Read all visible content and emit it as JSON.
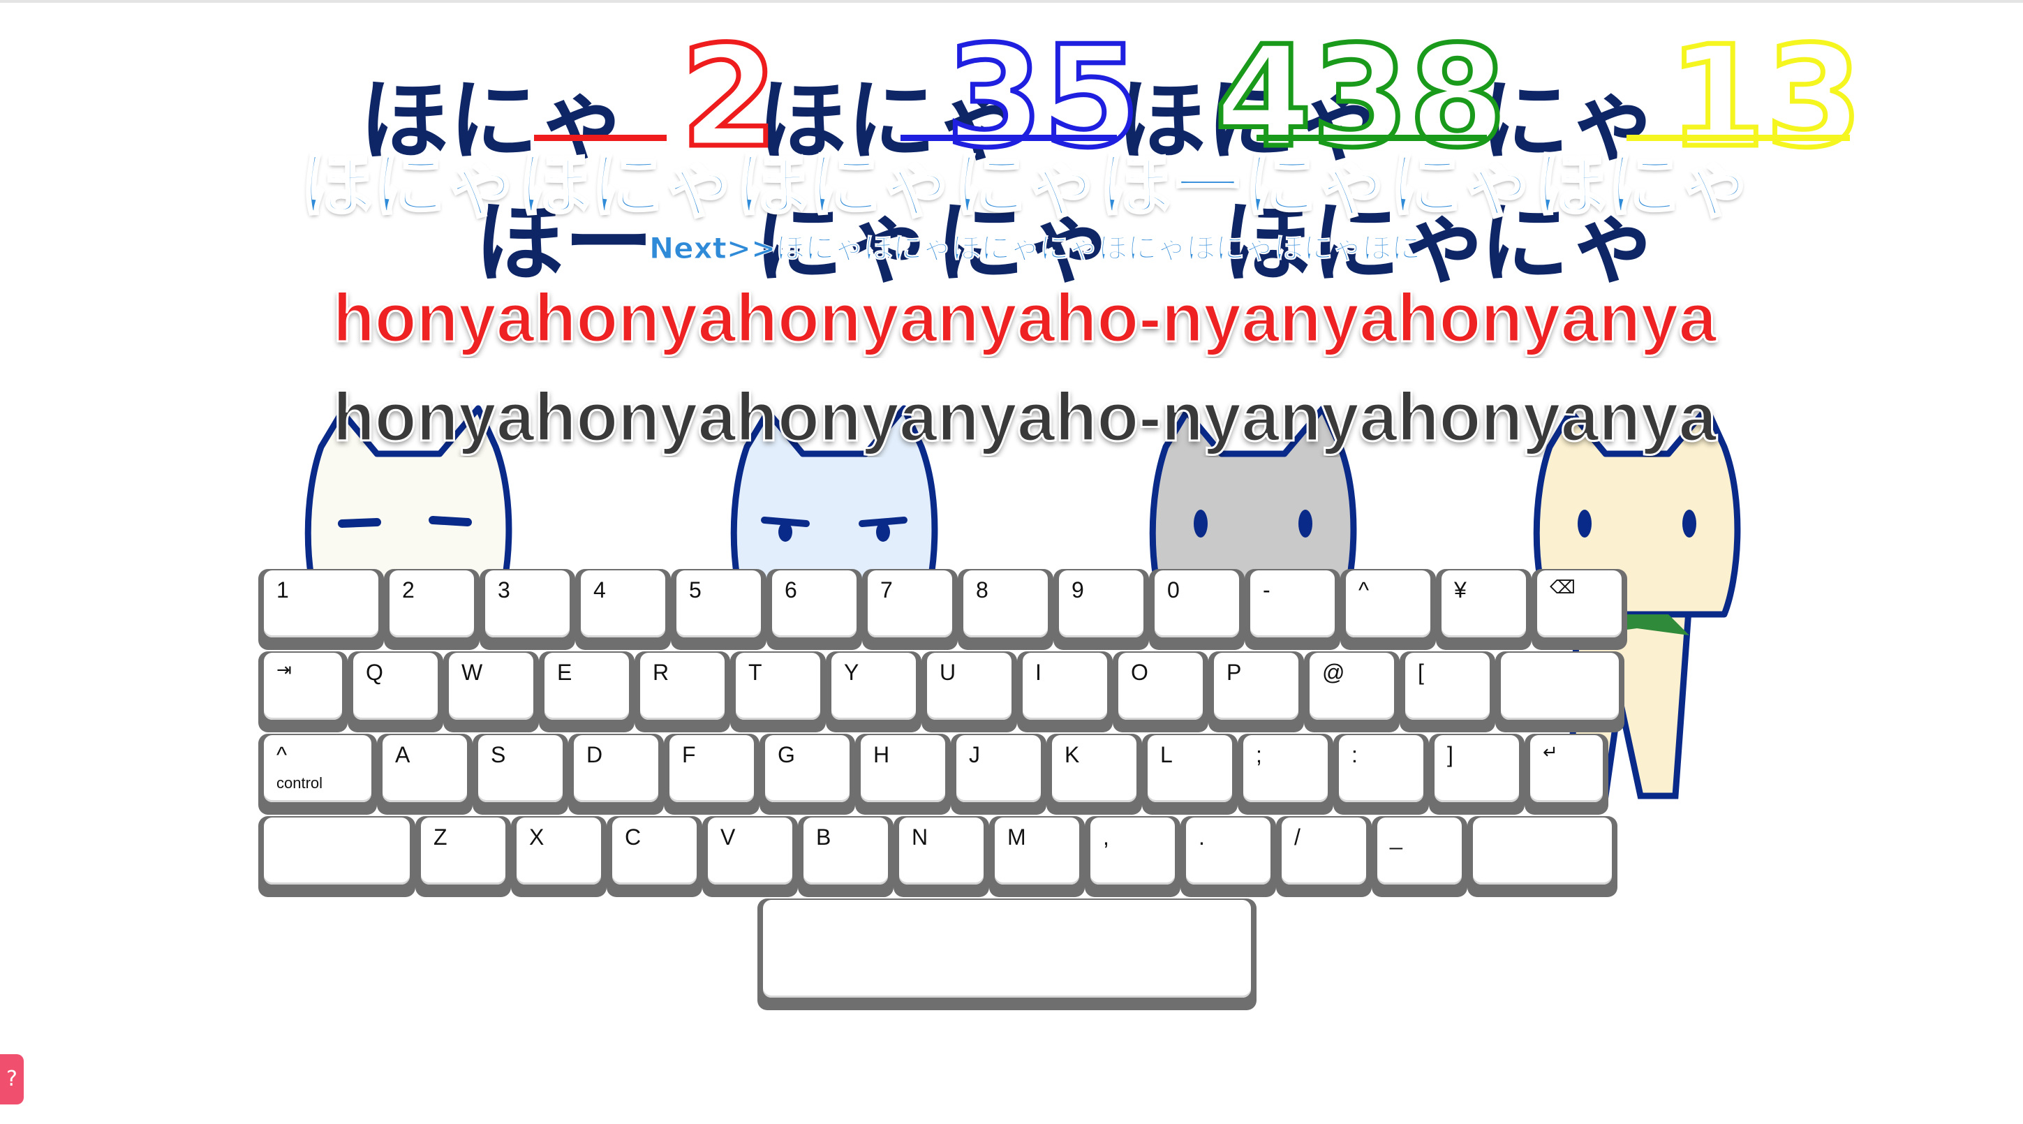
{
  "background_words": [
    {
      "text": "ほにゃ",
      "color": "#0e2566"
    },
    {
      "text": "ほにゃ",
      "color": "#0e2566"
    },
    {
      "text": "ほにゃ",
      "color": "#0e2566"
    },
    {
      "text": "にゃ",
      "color": "#0e2566"
    },
    {
      "text": "ほー",
      "color": "#0e2566"
    },
    {
      "text": "にゃ",
      "color": "#0e2566"
    },
    {
      "text": "にゃ",
      "color": "#0e2566"
    },
    {
      "text": "ほにゃ",
      "color": "#0e2566"
    },
    {
      "text": "にゃ",
      "color": "#0e2566"
    }
  ],
  "scores": [
    {
      "value": "2",
      "color": "#ee1c1c"
    },
    {
      "value": "35",
      "color": "#1f1fe0"
    },
    {
      "value": "438",
      "color": "#1a9a1a"
    },
    {
      "value": "13",
      "color": "#f5f520"
    }
  ],
  "typing": {
    "current_kana": "ほにゃほにゃほにゃにゃほーにゃにゃほにゃにゃ",
    "next_label": "Next>>",
    "next_kana": "ほにゃほにゃほにゃにゃほにゃほにゃほにゃほにゃ",
    "typed_romaji": "honyahonyahonyanyaho-nyanyahonyanya",
    "remaining_romaji": "honyahonyahonyanyaho-nyanyahonyanya"
  },
  "cats": [
    {
      "name": "white-cat",
      "body_color": "#fbfaf2",
      "accent_color": "#e0401e"
    },
    {
      "name": "blue-cat",
      "body_color": "#e2eefb",
      "accent_color": "#2a6ee0"
    },
    {
      "name": "gray-cat",
      "body_color": "#c9c9c9",
      "accent_color": "#6a5fb0"
    },
    {
      "name": "cream-cat",
      "body_color": "#fbf0cf",
      "accent_color": "#2f8a3a"
    }
  ],
  "keyboard": {
    "rows": [
      [
        {
          "label": "1"
        },
        {
          "label": "2"
        },
        {
          "label": "3"
        },
        {
          "label": "4"
        },
        {
          "label": "5"
        },
        {
          "label": "6"
        },
        {
          "label": "7"
        },
        {
          "label": "8"
        },
        {
          "label": "9"
        },
        {
          "label": "0"
        },
        {
          "label": "-"
        },
        {
          "label": "^"
        },
        {
          "label": "¥"
        },
        {
          "label": "⌫",
          "icon": "backspace-icon"
        }
      ],
      [
        {
          "label": "⇥",
          "icon": "tab-icon"
        },
        {
          "label": "Q"
        },
        {
          "label": "W"
        },
        {
          "label": "E"
        },
        {
          "label": "R"
        },
        {
          "label": "T"
        },
        {
          "label": "Y"
        },
        {
          "label": "U"
        },
        {
          "label": "I"
        },
        {
          "label": "O"
        },
        {
          "label": "P"
        },
        {
          "label": "@"
        },
        {
          "label": "["
        },
        {
          "label": ""
        }
      ],
      [
        {
          "label": "^",
          "sub": "control"
        },
        {
          "label": "A"
        },
        {
          "label": "S"
        },
        {
          "label": "D"
        },
        {
          "label": "F"
        },
        {
          "label": "G"
        },
        {
          "label": "H"
        },
        {
          "label": "J"
        },
        {
          "label": "K"
        },
        {
          "label": "L"
        },
        {
          "label": ";"
        },
        {
          "label": ":"
        },
        {
          "label": "]"
        },
        {
          "label": "↵",
          "icon": "return-icon"
        }
      ],
      [
        {
          "label": ""
        },
        {
          "label": "Z"
        },
        {
          "label": "X"
        },
        {
          "label": "C"
        },
        {
          "label": "V"
        },
        {
          "label": "B"
        },
        {
          "label": "N"
        },
        {
          "label": "M"
        },
        {
          "label": ","
        },
        {
          "label": "."
        },
        {
          "label": "/"
        },
        {
          "label": "_"
        },
        {
          "label": ""
        }
      ],
      [
        {
          "label": ""
        }
      ]
    ]
  },
  "help_button": {
    "icon": "help-icon",
    "label": "?"
  }
}
